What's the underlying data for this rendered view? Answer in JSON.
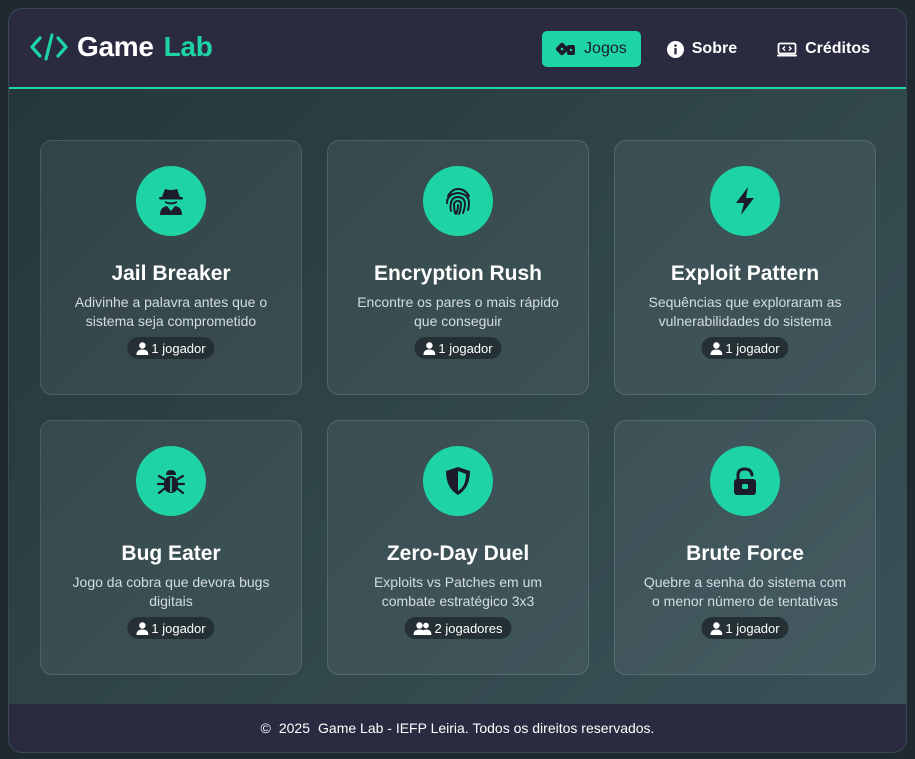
{
  "header": {
    "logo_word": "Game",
    "logo_accent": "Lab",
    "logo_icon": "code-icon",
    "nav": [
      {
        "label": "Jogos",
        "icon": "dice-icon",
        "active": true
      },
      {
        "label": "Sobre",
        "icon": "info-icon",
        "active": false
      },
      {
        "label": "Créditos",
        "icon": "credits-icon",
        "active": false
      }
    ]
  },
  "games": [
    {
      "title": "Jail Breaker",
      "description": "Adivinhe a palavra antes que o sistema seja comprometido",
      "players": "1 jogador",
      "icon": "spy-icon"
    },
    {
      "title": "Encryption Rush",
      "description": "Encontre os pares o mais rápido que conseguir",
      "players": "1 jogador",
      "icon": "fingerprint-icon"
    },
    {
      "title": "Exploit Pattern",
      "description": "Sequências que exploraram as vulnerabilidades do sistema",
      "players": "1 jogador",
      "icon": "bolt-icon"
    },
    {
      "title": "Bug Eater",
      "description": "Jogo da cobra que devora bugs digitais",
      "players": "1 jogador",
      "icon": "bug-icon"
    },
    {
      "title": "Zero-Day Duel",
      "description": "Exploits vs Patches em um combate estratégico 3x3",
      "players": "2 jogadores",
      "icon": "shield-icon"
    },
    {
      "title": "Brute Force",
      "description": "Quebre a senha do sistema com o menor número de tentativas",
      "players": "1 jogador",
      "icon": "unlock-icon"
    }
  ],
  "footer": {
    "copyright_symbol": "©",
    "year": "2025",
    "text": "Game Lab - IEFP Leiria. Todos os direitos reservados."
  },
  "colors": {
    "accent": "#1fd4a4",
    "header_bg": "#2a2a40",
    "card_text": "#d4dde0"
  }
}
